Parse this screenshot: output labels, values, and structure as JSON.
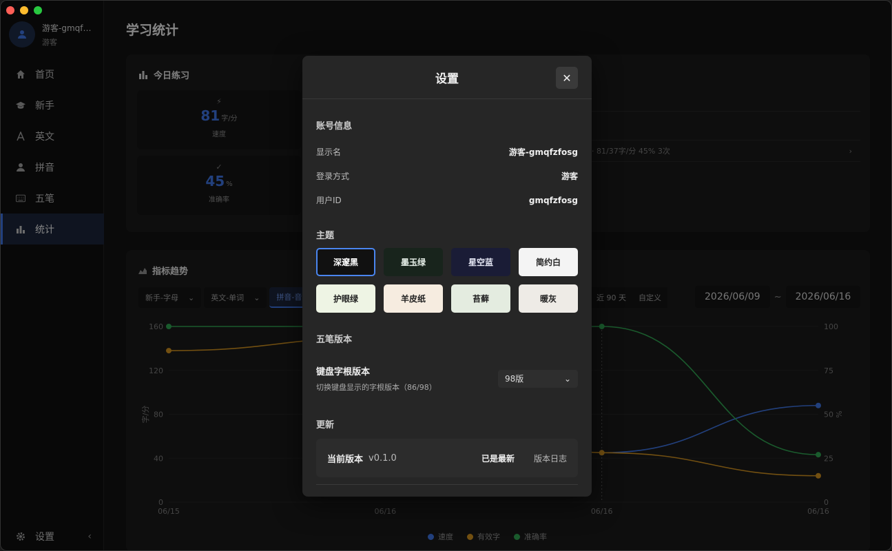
{
  "sidebar": {
    "user_name": "游客-gmqf…",
    "user_role": "游客",
    "items": [
      {
        "label": "首页",
        "icon": "home-icon"
      },
      {
        "label": "新手",
        "icon": "graduation-cap-icon"
      },
      {
        "label": "英文",
        "icon": "letter-a-icon"
      },
      {
        "label": "拼音",
        "icon": "person-icon"
      },
      {
        "label": "五笔",
        "icon": "keyboard-icon"
      },
      {
        "label": "统计",
        "icon": "bar-chart-icon"
      }
    ],
    "active_index": 5,
    "settings_label": "设置",
    "collapse_glyph": "‹"
  },
  "main": {
    "title": "学习统计",
    "today": {
      "title": "今日练习",
      "speed": {
        "value": "81",
        "unit": "字/分",
        "label": "速度"
      },
      "accuracy": {
        "value": "45",
        "unit": "%",
        "label": "准确率"
      },
      "record_text": "· 81/37字/分 45% 3次",
      "record_chevron": "›"
    },
    "trend": {
      "title": "指标趋势",
      "filters": [
        "新手-字母",
        "英文-单词",
        "拼音-音"
      ],
      "ranges": [
        "近 90 天",
        "自定义"
      ],
      "date_from": "2026/06/09",
      "date_sep": "~",
      "date_to": "2026/06/16",
      "legend": [
        {
          "label": "速度",
          "color": "#3b6fd8"
        },
        {
          "label": "有效字",
          "color": "#c68a1e"
        },
        {
          "label": "准确率",
          "color": "#2e9d4f"
        }
      ]
    }
  },
  "chart_data": {
    "type": "line",
    "x": [
      "06/15",
      "06/16",
      "06/16",
      "06/16"
    ],
    "y_left": {
      "label": "字/分",
      "ticks": [
        0,
        40,
        80,
        120,
        160
      ],
      "ylim": [
        0,
        160
      ]
    },
    "y_right": {
      "label": "%",
      "ticks": [
        0,
        25,
        50,
        75,
        100
      ],
      "ylim": [
        0,
        100
      ]
    },
    "series": [
      {
        "name": "速度",
        "axis": "left",
        "color": "#3b6fd8",
        "values": [
          null,
          null,
          45,
          88
        ]
      },
      {
        "name": "有效字",
        "axis": "left",
        "color": "#c68a1e",
        "values": [
          138,
          150,
          45,
          24
        ]
      },
      {
        "name": "准确率",
        "axis": "right",
        "color": "#2e9d4f",
        "values": [
          100,
          100,
          100,
          27
        ]
      }
    ]
  },
  "modal": {
    "title": "设置",
    "close_glyph": "✕",
    "account": {
      "section": "账号信息",
      "rows": [
        {
          "k": "显示名",
          "v": "游客-gmqfzfosg"
        },
        {
          "k": "登录方式",
          "v": "游客"
        },
        {
          "k": "用户ID",
          "v": "gmqfzfosg"
        }
      ]
    },
    "theme": {
      "section": "主题",
      "options": [
        {
          "label": "深邃黑",
          "bg": "#111111",
          "fg": "#ffffff"
        },
        {
          "label": "墨玉绿",
          "bg": "#18241c",
          "fg": "#e6efe8"
        },
        {
          "label": "星空蓝",
          "bg": "#1a1c36",
          "fg": "#e6e8f5"
        },
        {
          "label": "简约白",
          "bg": "#f4f4f4",
          "fg": "#222222"
        },
        {
          "label": "护眼绿",
          "bg": "#eef4e4",
          "fg": "#222222"
        },
        {
          "label": "羊皮纸",
          "bg": "#f6ece0",
          "fg": "#222222"
        },
        {
          "label": "苔藓",
          "bg": "#e4ece0",
          "fg": "#222222"
        },
        {
          "label": "暖灰",
          "bg": "#eeebe6",
          "fg": "#222222"
        }
      ],
      "selected_index": 0
    },
    "wubi": {
      "section": "五笔版本",
      "title": "键盘字根版本",
      "subtitle": "切换键盘显示的字根版本（86/98）",
      "selected": "98版"
    },
    "update": {
      "section": "更新",
      "label": "当前版本",
      "version": "v0.1.0",
      "status": "已是最新",
      "changelog": "版本日志"
    }
  }
}
